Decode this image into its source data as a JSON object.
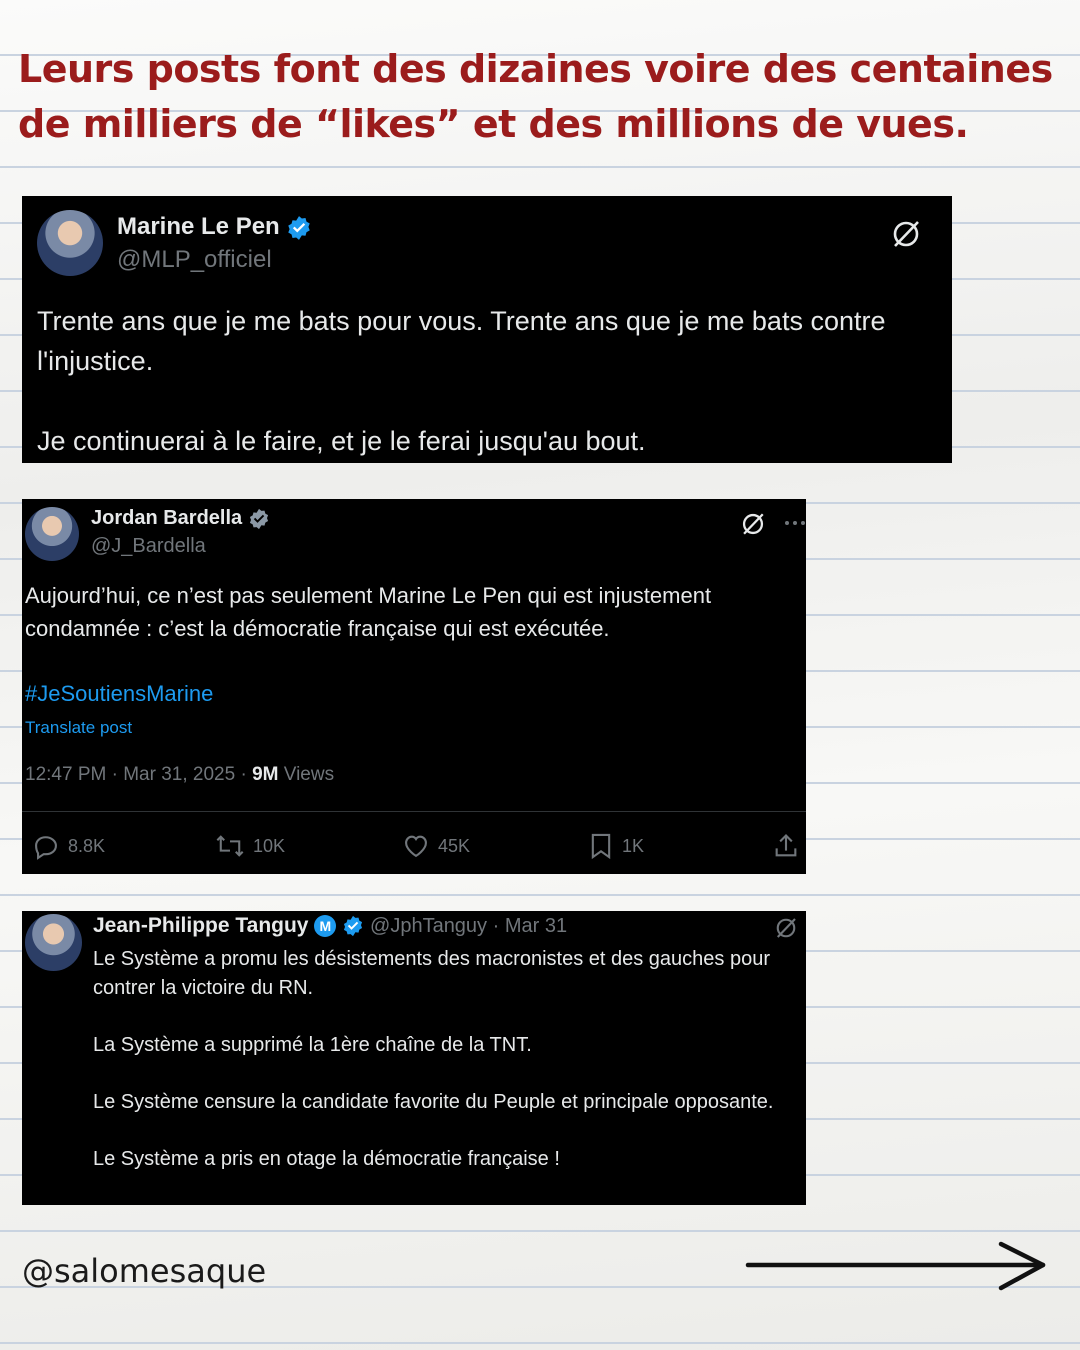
{
  "headline": "Leurs posts font des dizaines voire des centaines de milliers de “likes” et des millions de vues.",
  "tweets": [
    {
      "name": "Marine Le Pen",
      "handle": "@MLP_officiel",
      "paragraphs": [
        "Trente ans que je me bats pour vous. Trente ans que je me bats contre l'injustice.",
        "Je continuerai à le faire, et je le ferai jusqu'au bout."
      ]
    },
    {
      "name": "Jordan Bardella",
      "handle": "@J_Bardella",
      "text": "Aujourd’hui, ce n’est pas seulement Marine Le Pen qui est injustement condamnée : c’est la démocratie française qui est exécutée.",
      "hashtag": "#JeSoutiensMarine",
      "translate": "Translate post",
      "time": "12:47 PM · Mar 31, 2025 · ",
      "views_count": "9M",
      "views_label": " Views",
      "stats": {
        "replies": "8.8K",
        "reposts": "10K",
        "likes": "45K",
        "bookmarks": "1K"
      }
    },
    {
      "name": "Jean-Philippe Tanguy",
      "badge": "M",
      "handle": "@JphTanguy · Mar 31",
      "paragraphs": [
        "Le Système a promu les désistements des macronistes et des gauches pour contrer la victoire du RN.",
        "La Système a supprimé la 1ère chaîne de la TNT.",
        "Le Système censure la candidate favorite du Peuple et principale opposante.",
        "Le Système a pris en otage la démocratie française !"
      ]
    }
  ],
  "footer": {
    "handle": "@salomesaque"
  },
  "colors": {
    "headline": "#9b1c1c",
    "link": "#1d9bf0",
    "muted": "#71767b",
    "card": "#000000"
  },
  "icons": [
    "verified-badge-icon",
    "grok-icon",
    "more-icon",
    "reply-icon",
    "repost-icon",
    "like-icon",
    "bookmark-icon",
    "share-icon",
    "arrow-right-icon"
  ]
}
